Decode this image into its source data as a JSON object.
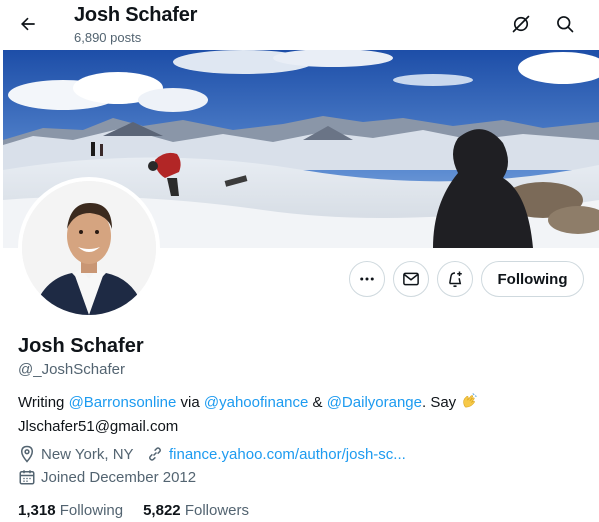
{
  "header": {
    "title": "Josh Schafer",
    "posts_count": "6,890 posts",
    "back_icon": "arrow-left-icon",
    "lens_icon": "grok-lens-icon",
    "search_icon": "search-icon"
  },
  "profile": {
    "name": "Josh Schafer",
    "handle": "@_JoshSchafer",
    "bio": {
      "prefix": "Writing ",
      "mention1": "@Barronsonline",
      "via": " via ",
      "mention2": "@yahoofinance",
      "amp": " & ",
      "mention3": "@Dailyorange",
      "say": ". Say ",
      "email": "Jlschafer51@gmail.com"
    },
    "location": "New York, NY",
    "website": "finance.yahoo.com/author/josh-sc...",
    "joined": "Joined December 2012"
  },
  "actions": {
    "more_icon": "more-icon",
    "message_icon": "envelope-icon",
    "notify_icon": "bell-plus-icon",
    "following_label": "Following"
  },
  "stats": {
    "following_count": "1,318",
    "following_label": "Following",
    "followers_count": "5,822",
    "followers_label": "Followers"
  },
  "colors": {
    "link": "#1d9bf0",
    "text": "#0f1419",
    "secondary": "#536471",
    "border": "#cfd9de"
  }
}
